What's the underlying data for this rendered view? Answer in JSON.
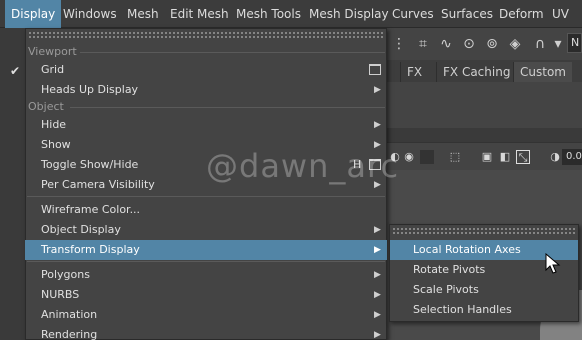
{
  "menubar": [
    "Display",
    "Windows",
    "Mesh",
    "Edit Mesh",
    "Mesh Tools",
    "Mesh Display",
    "Curves",
    "Surfaces",
    "Deform",
    "UV"
  ],
  "toolbar": {
    "field_text": "N"
  },
  "shelf": {
    "tabs": [
      "FX",
      "FX Caching",
      "Custom"
    ]
  },
  "panel": {
    "value": "0.0"
  },
  "menu": {
    "viewport_header": "Viewport",
    "grid": "Grid",
    "heads_up_display": "Heads Up Display",
    "object_header": "Object",
    "hide": "Hide",
    "show": "Show",
    "toggle_show_hide": "Toggle Show/Hide",
    "toggle_hotkey": "H",
    "per_camera_visibility": "Per Camera Visibility",
    "wireframe_color": "Wireframe Color...",
    "object_display": "Object Display",
    "transform_display": "Transform Display",
    "polygons": "Polygons",
    "nurbs": "NURBS",
    "animation": "Animation",
    "rendering": "Rendering"
  },
  "submenu": [
    "Local Rotation Axes",
    "Rotate Pivots",
    "Scale Pivots",
    "Selection Handles"
  ],
  "watermark": "@dawn_arc",
  "colors": {
    "highlight": "#5285a6",
    "menu_bg": "#444444"
  }
}
